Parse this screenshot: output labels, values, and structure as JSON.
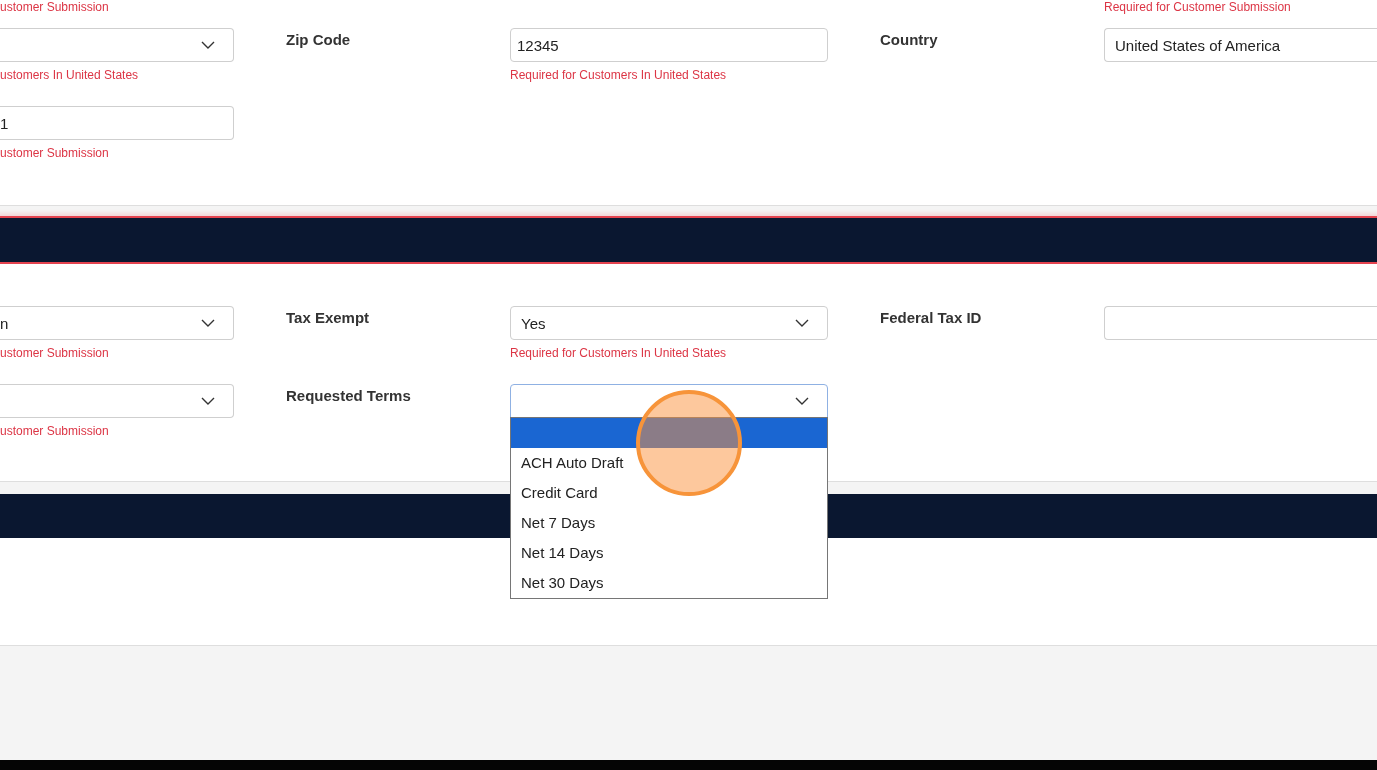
{
  "sections": [
    {
      "rows": [
        {
          "left": {
            "hint": "ustomer Submission"
          },
          "right": {
            "hint": "Required for Customer Submission"
          }
        },
        {
          "left": {
            "kind": "select",
            "expanded": false,
            "hint": "ustomers In United States"
          },
          "middle": {
            "label": "Zip Code",
            "kind": "input",
            "value": "12345",
            "hint": "Required for Customers In United States"
          },
          "right": {
            "label": "Country",
            "kind": "input",
            "value": "United States of America"
          }
        },
        {
          "left": {
            "kind": "input",
            "value": "1",
            "hint": "ustomer Submission"
          }
        }
      ]
    },
    {
      "header": {
        "highlighted": true
      },
      "rows": [
        {
          "left": {
            "kind": "select",
            "expanded": false,
            "value": "n",
            "hint": "ustomer Submission"
          },
          "middle": {
            "label": "Tax Exempt",
            "kind": "select",
            "expanded": false,
            "value": "Yes",
            "hint": "Required for Customers In United States"
          },
          "right": {
            "label": "Federal Tax ID",
            "kind": "input"
          }
        },
        {
          "left": {
            "kind": "select",
            "expanded": false,
            "hint": "ustomer Submission"
          },
          "middle": {
            "label": "Requested Terms",
            "kind": "select",
            "expanded": true,
            "options": [
              {
                "selected": true
              },
              {
                "label": "ACH Auto Draft",
                "selected": false
              },
              {
                "label": "Credit Card",
                "selected": false
              },
              {
                "label": "Net 7 Days",
                "selected": false
              },
              {
                "label": "Net 14 Days",
                "selected": false
              },
              {
                "label": "Net 30 Days",
                "selected": false
              }
            ]
          }
        }
      ]
    },
    {
      "header": {
        "highlighted": false
      }
    }
  ]
}
